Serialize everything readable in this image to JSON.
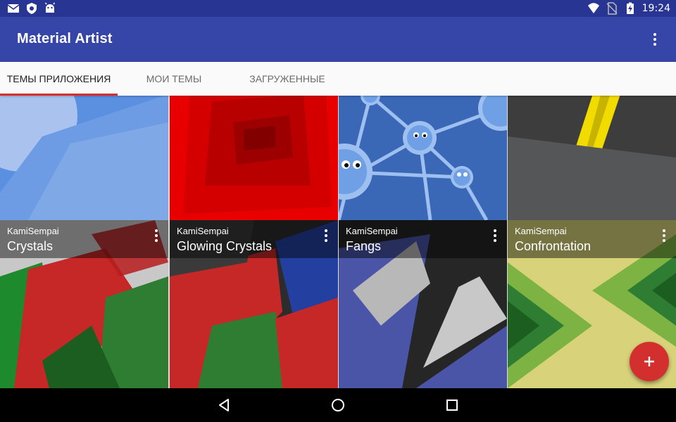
{
  "status_bar": {
    "time": "19:24",
    "left_icons": [
      "mail-icon",
      "shield-icon",
      "android-icon"
    ],
    "right_icons": [
      "wifi-icon",
      "no-sim-icon",
      "battery-charging-icon"
    ]
  },
  "app_bar": {
    "title": "Material Artist",
    "overflow_icon": "more-vert-icon"
  },
  "tabs": [
    {
      "label": "ТЕМЫ ПРИЛОЖЕНИЯ",
      "active": true
    },
    {
      "label": "МОИ ТЕМЫ",
      "active": false
    },
    {
      "label": "ЗАГРУЖЕННЫЕ",
      "active": false
    }
  ],
  "accent_color": "#d32f2f",
  "primary_color": "#3545a8",
  "themes": [
    {
      "author": "KamiSempai",
      "name": "Crystals"
    },
    {
      "author": "KamiSempai",
      "name": "Glowing Crystals"
    },
    {
      "author": "KamiSempai",
      "name": "Fangs"
    },
    {
      "author": "KamiSempai",
      "name": "Confrontation"
    }
  ],
  "fab": {
    "icon": "add-icon"
  },
  "nav_bar": {
    "icons": [
      "back-icon",
      "home-icon",
      "recents-icon"
    ]
  }
}
